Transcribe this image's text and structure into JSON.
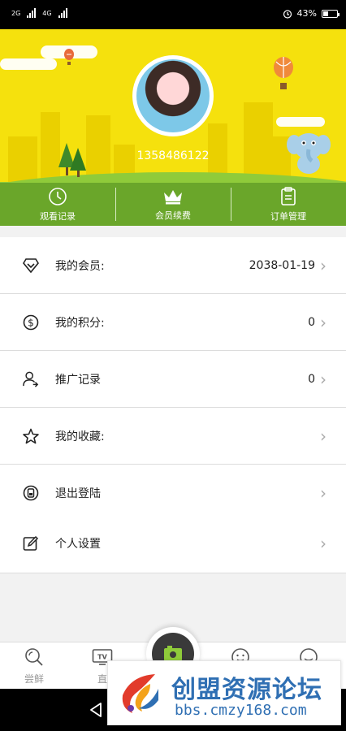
{
  "status_bar": {
    "net1": "2G",
    "net2": "4G",
    "right_text": "43%"
  },
  "profile": {
    "phone": "1358486122"
  },
  "shortcuts": [
    {
      "label": "观看记录",
      "icon": "clock-icon"
    },
    {
      "label": "会员续费",
      "icon": "crown-icon"
    },
    {
      "label": "订单管理",
      "icon": "clipboard-icon"
    }
  ],
  "menu": [
    {
      "label": "我的会员:",
      "value": "2038-01-19",
      "icon": "diamond-icon"
    },
    {
      "label": "我的积分:",
      "value": "0",
      "icon": "coin-icon"
    },
    {
      "label": "推广记录",
      "value": "0",
      "icon": "user-share-icon"
    },
    {
      "label": "我的收藏:",
      "value": "",
      "icon": "star-icon"
    },
    {
      "label": "退出登陆",
      "value": "",
      "icon": "logout-icon"
    }
  ],
  "settings": {
    "label": "个人设置",
    "icon": "edit-icon"
  },
  "tabs": [
    {
      "label": "尝鲜",
      "icon": "search-icon"
    },
    {
      "label": "直",
      "icon": "tv-icon"
    }
  ],
  "watermark": {
    "title": "创盟资源论坛",
    "url": "bbs.cmzy168.com"
  },
  "colors": {
    "header_bg": "#f5e10d",
    "shortcut_bg": "#6aa62a",
    "accent": "#2f6fb3"
  }
}
